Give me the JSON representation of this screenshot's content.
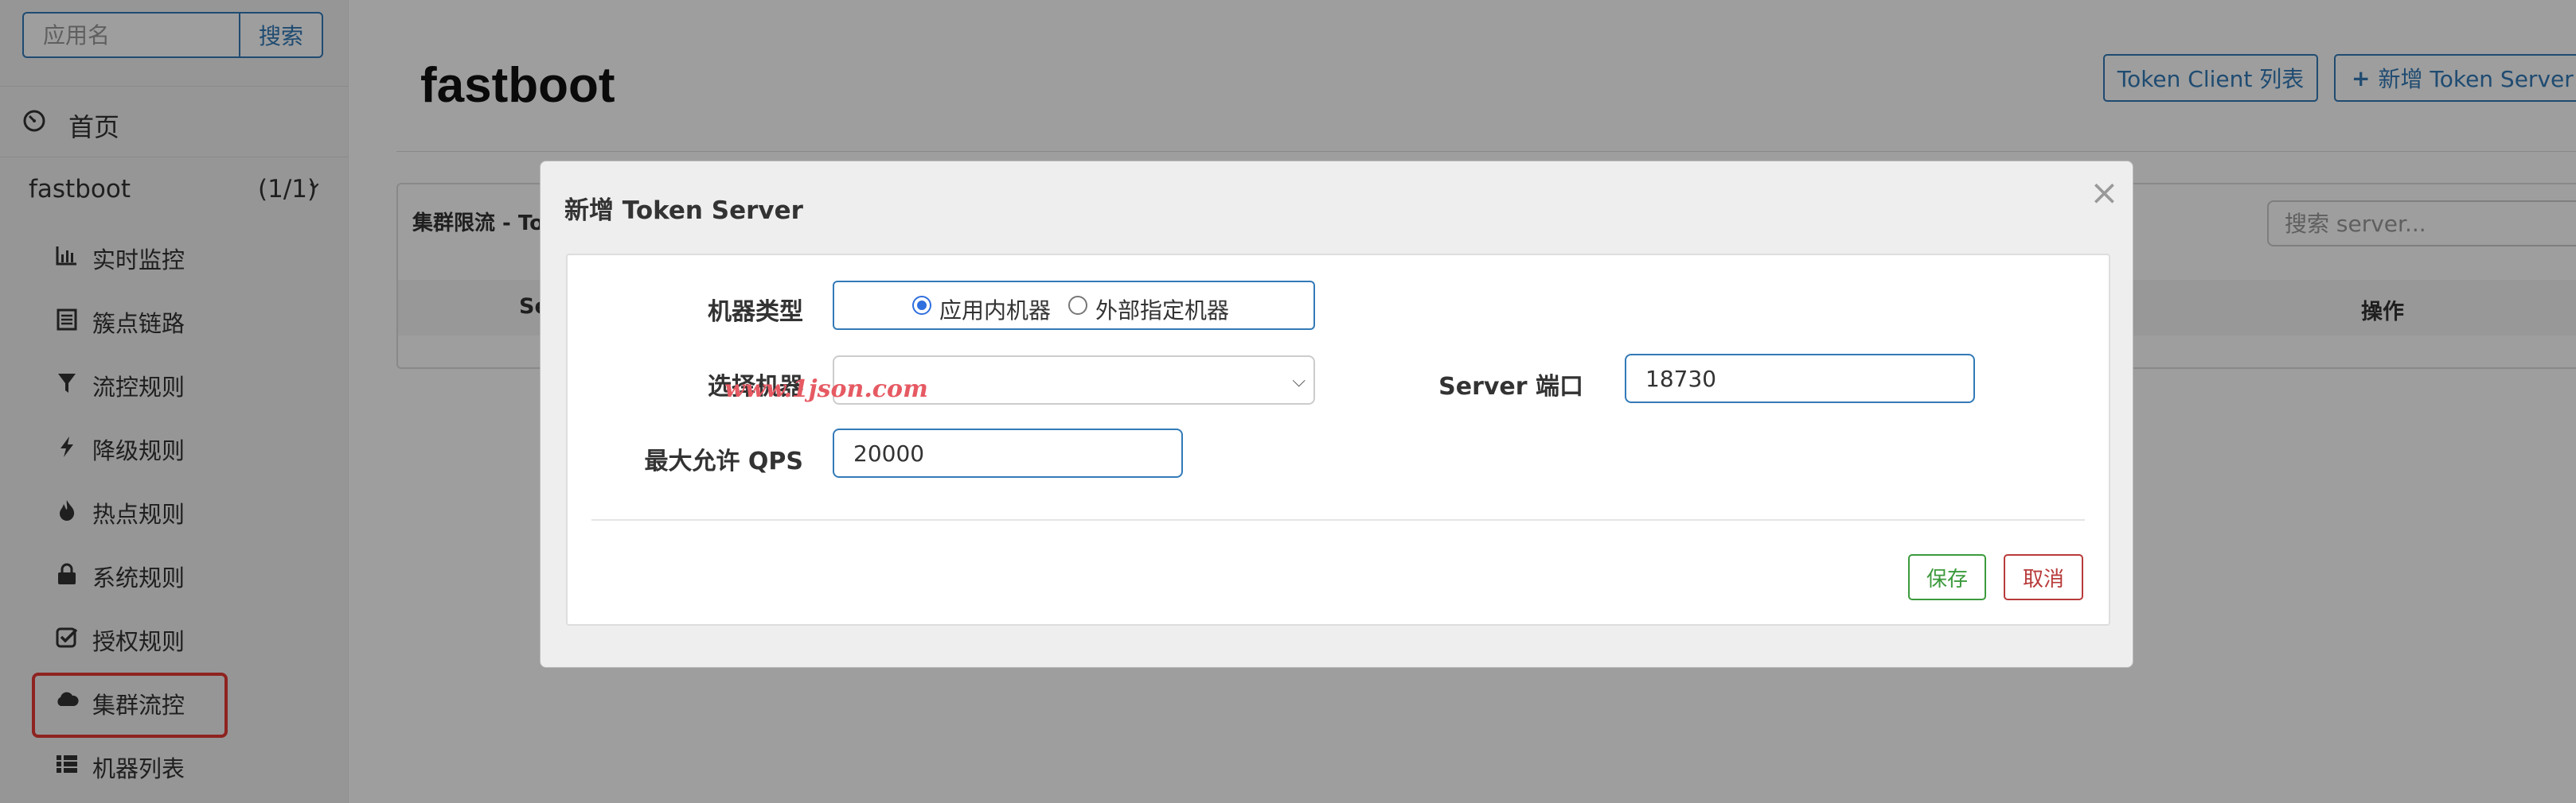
{
  "sidebar": {
    "search_placeholder": "应用名",
    "search_button": "搜索",
    "home": {
      "icon": "dashboard-icon",
      "label": "首页"
    },
    "app": {
      "name": "fastboot",
      "count": "(1/1)"
    },
    "menu": [
      {
        "icon": "bar-chart-icon",
        "label": "实时监控"
      },
      {
        "icon": "list-alt-icon",
        "label": "簇点链路"
      },
      {
        "icon": "filter-icon",
        "label": "流控规则"
      },
      {
        "icon": "flash-icon",
        "label": "降级规则"
      },
      {
        "icon": "fire-icon",
        "label": "热点规则"
      },
      {
        "icon": "lock-icon",
        "label": "系统规则"
      },
      {
        "icon": "check-square-icon",
        "label": "授权规则"
      },
      {
        "icon": "cloud-icon",
        "label": "集群流控"
      },
      {
        "icon": "th-list-icon",
        "label": "机器列表"
      }
    ]
  },
  "main": {
    "title": "fastboot",
    "token_client_button": "Token Client 列表",
    "add_token_server_button": "新增 Token Server",
    "panel_title": "集群限流 - To",
    "server_search_placeholder": "搜索 server...",
    "table_headers": [
      "Se",
      "操作"
    ]
  },
  "modal": {
    "title": "新增 Token Server",
    "close": "×",
    "machine_type_label": "机器类型",
    "radio_options": [
      "应用内机器",
      "外部指定机器"
    ],
    "radio_selected": 0,
    "select_machine_label": "选择机器",
    "select_machine_value": "",
    "server_port_label": "Server 端口",
    "server_port_value": "18730",
    "max_qps_label": "最大允许 QPS",
    "max_qps_value": "20000",
    "save_button": "保存",
    "cancel_button": "取消"
  },
  "watermark": "www.1json.com",
  "colors": {
    "primary": "#337ab7",
    "save": "#3c9a3c",
    "cancel": "#b93a3a",
    "highlight": "#e53935",
    "watermark": "#e65a63"
  }
}
